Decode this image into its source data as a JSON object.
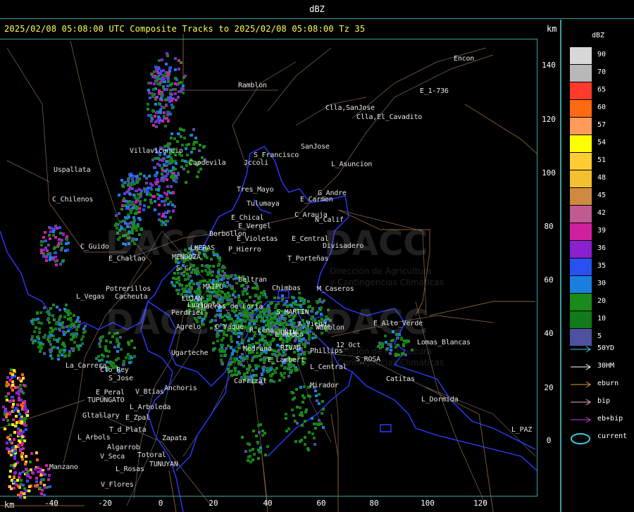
{
  "header": {
    "unit_title": "dBZ"
  },
  "map": {
    "title": "2025/02/08 05:08:00 UTC Composite Tracks to 2025/02/08 05:08:00 Tz 35",
    "km_label": "km",
    "y_ticks": [
      "140",
      "120",
      "100",
      "80",
      "60",
      "40",
      "20",
      "0"
    ],
    "x_ticks": [
      "-40",
      "-20",
      "0",
      "20",
      "40",
      "60",
      "80",
      "100",
      "120"
    ],
    "places": [
      "Ramblon",
      "Encon",
      "Clla,SanJose",
      "Clla,El_Cavadito",
      "E_1-736",
      "SanJose",
      "S_Francisco",
      "Jccoli",
      "L_Asuncion",
      "Villavicencio",
      "Uspallata",
      "Capdevila",
      "Tres_Mayo",
      "G_Andre",
      "Tulumaya",
      "E_Carmen",
      "C_Chilenos",
      "E_Chical",
      "E_Vergel",
      "C_Arauja",
      "N_Calif",
      "Borbollon",
      "E_Violetas",
      "E_Central",
      "Divisadero",
      "C_Guido",
      "LHERAS",
      "P_Hierro",
      "MENDOZA",
      "S_Cr",
      "E_Challao",
      "T_Porteñas",
      "Potrerillos",
      "Cacheuta",
      "MAIPU",
      "Beltran",
      "Chimbas",
      "M_Caseros",
      "L_Vegas",
      "LUJAN",
      "S_MARTIN",
      "Perdriel",
      "Lunlunta",
      "A_Vieda",
      "Wamblon",
      "Agrelo",
      "R_Lena",
      "JUNIN",
      "RIVAD",
      "Phillips",
      "12_Oct",
      "Lomas_Blancas",
      "Ugarteche",
      "La_Carrera",
      "Cto_Rey",
      "S_Jose",
      "S_ROSA",
      "L_Central",
      "Catitas",
      "Carrizal",
      "Mirador",
      "E_Peral",
      "V_Btias",
      "TUPUNGATO",
      "Anchoris",
      "L_Dormida",
      "L_Arboleda",
      "Gltallary",
      "E_Zpal",
      "L_PAZ",
      "T_d_Plata",
      "L_Arbols",
      "Zapata",
      "Algarrob",
      "V_Seca",
      "Totoral",
      "Manzano",
      "L_Rosas",
      "TUNUYAN",
      "V_Flores",
      "C_Yaque",
      "E_Lambert",
      "Medrano",
      "Chacras_de_Coria",
      "E_Alto_Verde",
      "E_Rodeo"
    ]
  },
  "watermarks": {
    "brand": "DACC",
    "tagline_1": "Dirección de Agricultura",
    "tagline_2": "y Contingencias Climáticas"
  },
  "legend": {
    "title": "dBZ",
    "levels": [
      {
        "label": "90",
        "color": "#d8d8d8"
      },
      {
        "label": "70",
        "color": "#b8b8b8"
      },
      {
        "label": "65",
        "color": "#ff3a2a"
      },
      {
        "label": "60",
        "color": "#ff6a10"
      },
      {
        "label": "57",
        "color": "#ff9a5a"
      },
      {
        "label": "54",
        "color": "#ffff00"
      },
      {
        "label": "51",
        "color": "#ffcc33"
      },
      {
        "label": "48",
        "color": "#f5c030"
      },
      {
        "label": "45",
        "color": "#d08a40"
      },
      {
        "label": "42",
        "color": "#c05a90"
      },
      {
        "label": "39",
        "color": "#d020a0"
      },
      {
        "label": "36",
        "color": "#8a20d0"
      },
      {
        "label": "35",
        "color": "#2a50f0"
      },
      {
        "label": "30",
        "color": "#1a80e0"
      },
      {
        "label": "20",
        "color": "#1a8a1a"
      },
      {
        "label": "10",
        "color": "#127a18"
      },
      {
        "label": "5",
        "color": "#5050a0"
      }
    ],
    "tracks": [
      {
        "label": "50YD",
        "color": "#40c8e0",
        "type": "arrow"
      },
      {
        "label": "30HM",
        "color": "#ffffff",
        "type": "arrow"
      },
      {
        "label": "eburn",
        "color": "#e0a030",
        "type": "arrow"
      },
      {
        "label": "bip",
        "color": "#f0b0c0",
        "type": "arrow"
      },
      {
        "label": "eb+bip",
        "color": "#c040d0",
        "type": "arrow"
      },
      {
        "label": "current",
        "color": "#40c8e0",
        "type": "ellipse"
      }
    ]
  }
}
